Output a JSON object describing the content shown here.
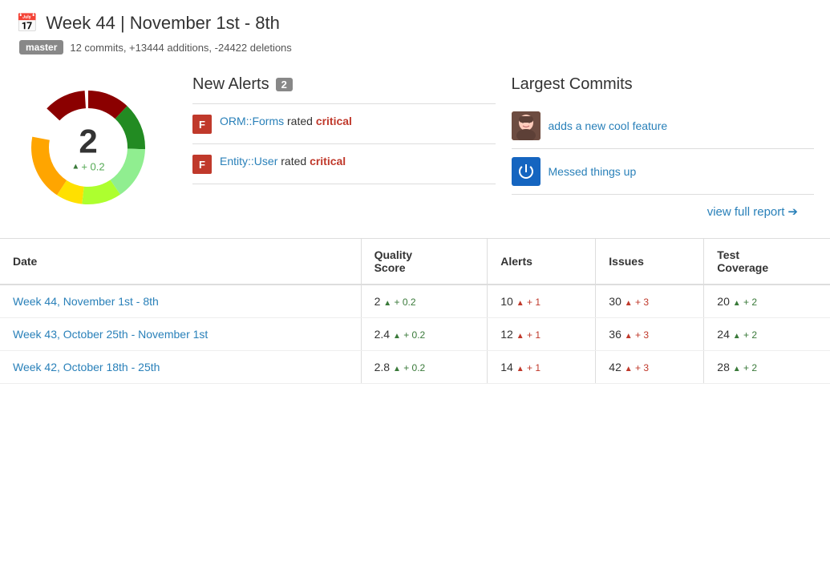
{
  "header": {
    "title": "Week 44 | November 1st - 8th",
    "branch": "master",
    "commits_info": "12 commits, +13444 additions, -24422 deletions"
  },
  "donut": {
    "score": "2",
    "delta_label": "+ 0.2",
    "segments": [
      {
        "color": "#8B0000",
        "pct": 12
      },
      {
        "color": "#228B22",
        "pct": 18
      },
      {
        "color": "#90EE90",
        "pct": 20
      },
      {
        "color": "#ADFF2F",
        "pct": 15
      },
      {
        "color": "#FFD700",
        "pct": 10
      },
      {
        "color": "#FFA500",
        "pct": 25
      }
    ]
  },
  "alerts": {
    "header": "New Alerts",
    "count": "2",
    "items": [
      {
        "badge": "F",
        "text_before": " rated",
        "link_text": "ORM::Forms",
        "text_after": " rated",
        "critical_label": "critical",
        "description": "ORM::Forms rated critical"
      },
      {
        "badge": "F",
        "link_text": "Entity::User",
        "text_after": " rated ",
        "critical_label": "critical",
        "description": "Entity::User rated critical"
      }
    ]
  },
  "largest_commits": {
    "header": "Largest Commits",
    "items": [
      {
        "avatar_type": "photo",
        "link_text": "adds a new cool feature"
      },
      {
        "avatar_type": "power",
        "link_text": "Messed things up"
      }
    ]
  },
  "view_report_label": "view full report",
  "table": {
    "columns": [
      "Date",
      "Quality\nScore",
      "Alerts",
      "Issues",
      "Test\nCoverage"
    ],
    "col_labels": [
      "Date",
      "Quality Score",
      "Alerts",
      "Issues",
      "Test Coverage"
    ],
    "rows": [
      {
        "date": "Week 44, November 1st - 8th",
        "score": "2",
        "score_delta": "+ 0.2",
        "alerts": "10",
        "alerts_delta": "+ 1",
        "issues": "30",
        "issues_delta": "+ 3",
        "coverage": "20",
        "coverage_delta": "+ 2"
      },
      {
        "date": "Week 43, October 25th - November 1st",
        "score": "2.4",
        "score_delta": "+ 0.2",
        "alerts": "12",
        "alerts_delta": "+ 1",
        "issues": "36",
        "issues_delta": "+ 3",
        "coverage": "24",
        "coverage_delta": "+ 2"
      },
      {
        "date": "Week 42, October 18th - 25th",
        "score": "2.8",
        "score_delta": "+ 0.2",
        "alerts": "14",
        "alerts_delta": "+ 1",
        "issues": "42",
        "issues_delta": "+ 3",
        "coverage": "28",
        "coverage_delta": "+ 2"
      }
    ]
  }
}
